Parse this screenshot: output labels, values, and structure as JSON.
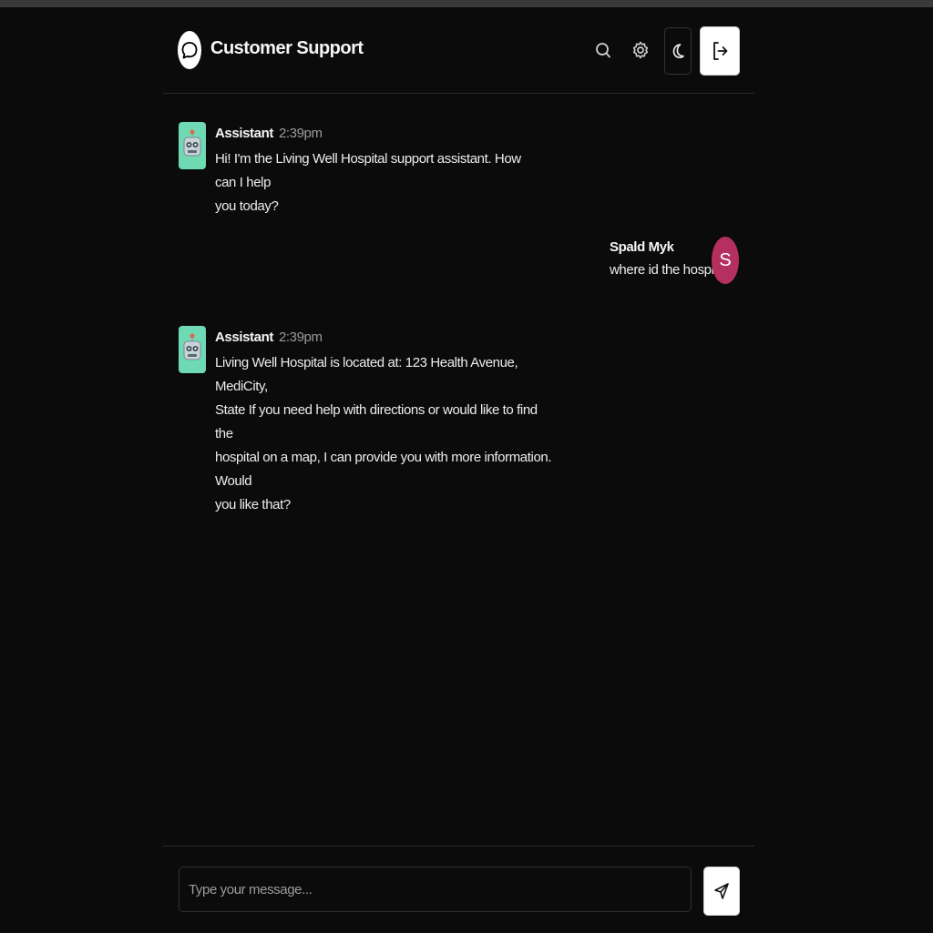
{
  "header": {
    "title": "Customer Support"
  },
  "messages": [
    {
      "author": "Assistant",
      "time": "2:39pm",
      "text_lines": [
        "Hi! I'm the Living Well Hospital support assistant. How can I help",
        "you today?"
      ]
    },
    {
      "author": "Spald Myk",
      "avatar_initial": "S",
      "text": "where id the hospital"
    },
    {
      "author": "Assistant",
      "time": "2:39pm",
      "text_lines": [
        "Living Well Hospital is located at: 123 Health Avenue, MediCity,",
        "State If you need help with directions or would like to find the",
        "hospital on a map, I can provide you with more information. Would",
        "you like that?"
      ]
    }
  ],
  "composer": {
    "placeholder": "Type your message..."
  },
  "colors": {
    "background": "#0b0b0b",
    "bot_avatar": "#6fd9b4",
    "user_avatar": "#b5305f"
  },
  "icons": {
    "logo": "chat-bubble-icon",
    "search": "search-icon",
    "settings": "gear-icon",
    "theme": "moon-icon",
    "logout": "logout-icon",
    "send": "send-icon",
    "bot": "robot-icon"
  }
}
